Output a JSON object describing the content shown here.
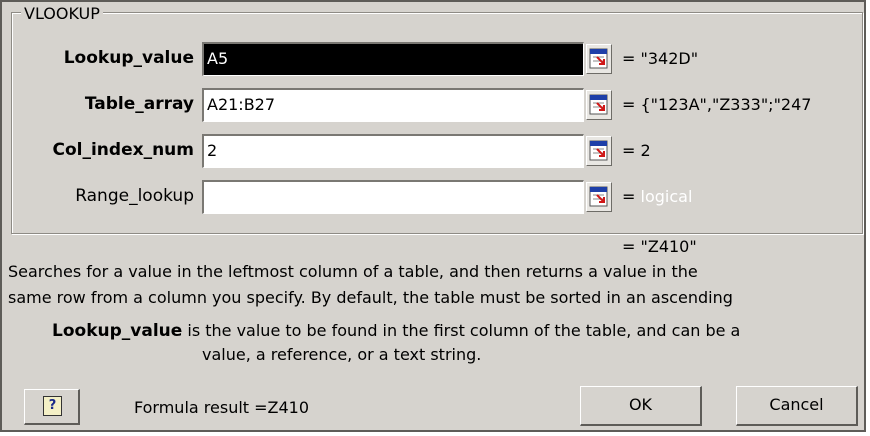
{
  "dialog": {
    "group_title": "VLOOKUP",
    "arguments": [
      {
        "label": "Lookup_value",
        "value": "A5",
        "evaluated": "= \"342D\""
      },
      {
        "label": "Table_array",
        "value": "A21:B27",
        "evaluated": "= {\"123A\",\"Z333\";\"247"
      },
      {
        "label": "Col_index_num",
        "value": "2",
        "evaluated": "= 2"
      },
      {
        "label": "Range_lookup",
        "value": "",
        "evaluated_prefix": "= ",
        "evaluated_hint": "logical"
      }
    ],
    "result": "= \"Z410\"",
    "description_line1": "Searches for a value in the leftmost column of a table, and then returns a value in the",
    "description_line2": "same row from a column you specify. By default, the table must be sorted in an ascending",
    "arg_help_name": "Lookup_value",
    "arg_help_text1": "is the value to be found in the first column of the table, and can be a",
    "arg_help_text2": "value, a reference, or a text string.",
    "formula_result": "Formula result =Z410",
    "ok_label": "OK",
    "cancel_label": "Cancel",
    "help_icon": "?"
  },
  "colors": {
    "dialog_bg": "#d6d3ce",
    "selection": "#000000"
  }
}
